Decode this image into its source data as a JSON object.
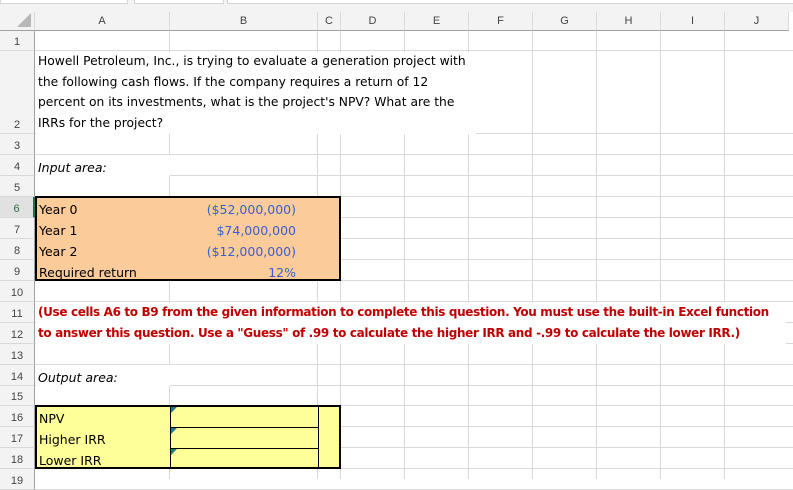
{
  "columns": [
    "A",
    "B",
    "C",
    "D",
    "E",
    "F",
    "G",
    "H",
    "I",
    "J"
  ],
  "rows": [
    "1",
    "2",
    "3",
    "4",
    "5",
    "6",
    "7",
    "8",
    "9",
    "10",
    "11",
    "12",
    "13",
    "14",
    "15",
    "16",
    "17",
    "18",
    "19"
  ],
  "question": "Howell Petroleum, Inc., is trying to evaluate a generation project with the following cash flows. If the company requires a return of 12 percent on its investments, what is the project's NPV? What are the IRRs for the project?",
  "input_label": "Input area:",
  "inputs": [
    {
      "label": "Year 0",
      "value": "($52,000,000)"
    },
    {
      "label": "Year 1",
      "value": "$74,000,000"
    },
    {
      "label": "Year 2",
      "value": "($12,000,000)"
    },
    {
      "label": "Required return",
      "value": "12%"
    }
  ],
  "instruction": "(Use cells A6 to B9 from the given information to complete this question. You must use the built-in Excel function to answer this question. Use a \"Guess\" of .99 to calculate the higher IRR and -.99 to calculate the lower IRR.)",
  "output_label": "Output area:",
  "outputs": [
    {
      "label": "NPV",
      "value": ""
    },
    {
      "label": "Higher IRR",
      "value": ""
    },
    {
      "label": "Lower IRR",
      "value": ""
    }
  ],
  "colors": {
    "input_fill": "#fccb9a",
    "output_fill": "#ffff99",
    "instruction_text": "#c00000",
    "value_text": "#3a5fcd"
  }
}
